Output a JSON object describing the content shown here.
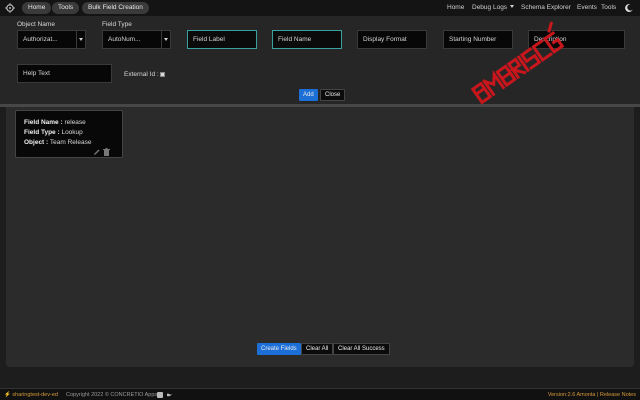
{
  "nav": {
    "home": "Home",
    "tools": "Tools",
    "bulk_field_creation": "Bulk Field Creation",
    "right": {
      "home": "Home",
      "debug_logs": "Debug Logs",
      "schema_explorer": "Schema Explorer",
      "events": "Events",
      "tools": "Tools"
    }
  },
  "form": {
    "object_name_label": "Object Name",
    "object_name_value": "Authorizat...",
    "field_type_label": "Field Type",
    "field_type_value": "AutoNum...",
    "field_label_placeholder": "Field Label",
    "field_name_placeholder": "Field Name",
    "display_format_placeholder": "Display Format",
    "starting_number_placeholder": "Starting Number",
    "description_placeholder": "Description",
    "help_text_placeholder": "Help Text",
    "external_id_label": "External Id :",
    "add_button": "Add",
    "close_button": "Close"
  },
  "card": {
    "field_name_key": "Field Name :",
    "field_name_value": "release",
    "field_type_key": "Field Type :",
    "field_type_value": "Lookup",
    "object_key": "Object :",
    "object_value": "Team Release"
  },
  "actions": {
    "create_fields": "Create Fields",
    "clear_all": "Clear All",
    "clear_all_success": "Clear All Success"
  },
  "footer": {
    "org": "sharingtest-dev-ed",
    "copyright": "Copyright 2022 © CONCRETIO Apps",
    "version": "Version:2.6 Amonta | Release Notes"
  },
  "colors": {
    "accent_blue": "#1d6fd8",
    "focus_teal": "#3ba0a0",
    "footer_orange": "#d79a3a",
    "watermark_red": "#c8161d"
  },
  "icons": {
    "logo": "gear-logo-icon",
    "theme": "moon-icon",
    "card_edit": "pencil-icon",
    "card_delete": "trash-icon",
    "footer_a": "linkedin-icon",
    "footer_b": "twitter-icon"
  }
}
